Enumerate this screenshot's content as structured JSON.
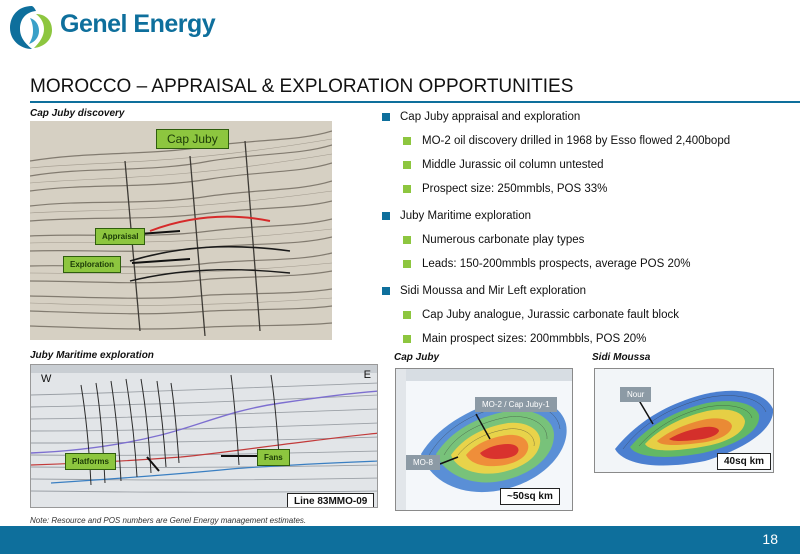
{
  "logo": {
    "text": "Genel Energy"
  },
  "title": "MOROCCO – APPRAISAL  & EXPLORATION OPPORTUNITIES",
  "panels": {
    "cap_juby_discovery": {
      "caption": "Cap Juby discovery",
      "label": "Cap Juby",
      "appraisal": "Appraisal",
      "exploration": "Exploration"
    },
    "juby_maritime": {
      "caption": "Juby Maritime exploration",
      "west": "W",
      "east": "E",
      "platforms": "Platforms",
      "fans": "Fans",
      "line": "Line 83MMO-09"
    },
    "cap_juby_map": {
      "caption": "Cap Juby",
      "mo2": "MO-2 / Cap Juby-1",
      "mo8": "MO-8",
      "area": "~50sq km"
    },
    "sidi_moussa_map": {
      "caption": "Sidi Moussa",
      "nour": "Nour",
      "area": "40sq km"
    }
  },
  "bullets": [
    {
      "text": "Cap Juby appraisal and exploration",
      "sub": [
        "MO-2 oil discovery drilled in 1968 by Esso flowed 2,400bopd",
        "Middle Jurassic oil column untested",
        "Prospect size: 250mmbls, POS 33%"
      ]
    },
    {
      "text": "Juby Maritime exploration",
      "sub": [
        "Numerous carbonate play types",
        "Leads: 150-200mmbls prospects, average POS 20%"
      ]
    },
    {
      "text": "Sidi Moussa and Mir Left exploration",
      "sub": [
        "Cap Juby analogue, Jurassic carbonate fault block",
        "Main prospect sizes: 200mmbbls, POS 20%"
      ]
    }
  ],
  "note": "Note: Resource and POS numbers are Genel Energy management estimates.",
  "page_number": "18",
  "colors": {
    "brand_blue": "#0e6f9c",
    "accent_green": "#8dc63f",
    "tag_grey": "#8c9aa5"
  }
}
